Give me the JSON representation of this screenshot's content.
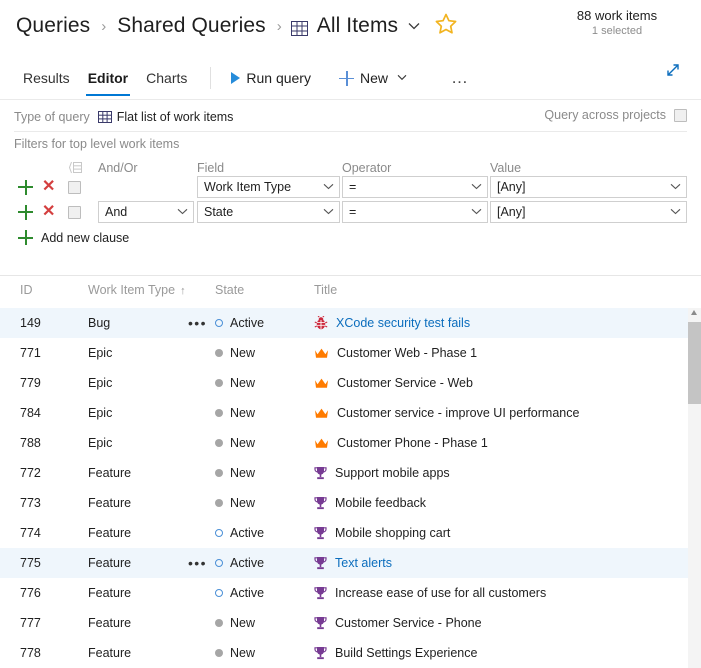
{
  "header": {
    "breadcrumb": [
      {
        "label": "Queries",
        "icon": null
      },
      {
        "label": "Shared Queries",
        "icon": null
      },
      {
        "label": "All Items",
        "icon": "grid-icon"
      }
    ],
    "separator": "›",
    "caret": "⌄",
    "favorite_icon": "star-icon",
    "count_main": "88 work items",
    "count_sub": "1 selected"
  },
  "toolbar": {
    "tabs": [
      {
        "label": "Results",
        "active": false
      },
      {
        "label": "Editor",
        "active": true
      },
      {
        "label": "Charts",
        "active": false
      }
    ],
    "run_query_label": "Run query",
    "run_query_icon": "play-icon",
    "new_label": "New",
    "new_icon": "plus-icon",
    "new_caret": "⌄",
    "overflow_label": "…",
    "expand_icon": "expand-diagonal-icon"
  },
  "query_options": {
    "type_of_query_label": "Type of query",
    "type_of_query_value": "Flat list of work items",
    "type_of_query_icon": "grid-icon",
    "query_across_projects_label": "Query across projects",
    "query_across_projects_checked": false
  },
  "filters": {
    "section_title": "Filters for top level work items",
    "group_icon": "clause-group-icon",
    "columns": {
      "andor": "And/Or",
      "field": "Field",
      "operator": "Operator",
      "value": "Value"
    },
    "add_icon": "plus-icon",
    "remove_icon": "close-icon",
    "caret": "⌄",
    "rows": [
      {
        "andor": "",
        "field": "Work Item Type",
        "operator": "=",
        "value": "[Any]",
        "checked": false
      },
      {
        "andor": "And",
        "field": "State",
        "operator": "=",
        "value": "[Any]",
        "checked": false
      }
    ],
    "add_new_clause_label": "Add new clause"
  },
  "grid": {
    "columns": [
      {
        "key": "id",
        "label": "ID",
        "sorted": false
      },
      {
        "key": "work_item_type",
        "label": "Work Item Type",
        "sorted": true,
        "sort_arrow": "↑"
      },
      {
        "key": "state",
        "label": "State",
        "sorted": false
      },
      {
        "key": "title",
        "label": "Title",
        "sorted": false
      }
    ],
    "rows": [
      {
        "id": "149",
        "type": "Bug",
        "state": "Active",
        "title": "XCode security test fails",
        "icon": "bug-icon",
        "selected": true,
        "menu": true,
        "link": true
      },
      {
        "id": "771",
        "type": "Epic",
        "state": "New",
        "title": "Customer Web - Phase 1",
        "icon": "crown-icon",
        "selected": false,
        "menu": false,
        "link": false
      },
      {
        "id": "779",
        "type": "Epic",
        "state": "New",
        "title": "Customer Service - Web",
        "icon": "crown-icon",
        "selected": false,
        "menu": false,
        "link": false
      },
      {
        "id": "784",
        "type": "Epic",
        "state": "New",
        "title": "Customer service - improve UI performance",
        "icon": "crown-icon",
        "selected": false,
        "menu": false,
        "link": false
      },
      {
        "id": "788",
        "type": "Epic",
        "state": "New",
        "title": "Customer Phone - Phase 1",
        "icon": "crown-icon",
        "selected": false,
        "menu": false,
        "link": false
      },
      {
        "id": "772",
        "type": "Feature",
        "state": "New",
        "title": "Support mobile apps",
        "icon": "trophy-icon",
        "selected": false,
        "menu": false,
        "link": false
      },
      {
        "id": "773",
        "type": "Feature",
        "state": "New",
        "title": "Mobile feedback",
        "icon": "trophy-icon",
        "selected": false,
        "menu": false,
        "link": false
      },
      {
        "id": "774",
        "type": "Feature",
        "state": "Active",
        "title": "Mobile shopping cart",
        "icon": "trophy-icon",
        "selected": false,
        "menu": false,
        "link": false
      },
      {
        "id": "775",
        "type": "Feature",
        "state": "Active",
        "title": "Text alerts",
        "icon": "trophy-icon",
        "selected": true,
        "menu": true,
        "link": true
      },
      {
        "id": "776",
        "type": "Feature",
        "state": "Active",
        "title": "Increase ease of use for all customers",
        "icon": "trophy-icon",
        "selected": false,
        "menu": false,
        "link": false
      },
      {
        "id": "777",
        "type": "Feature",
        "state": "New",
        "title": "Customer Service - Phone",
        "icon": "trophy-icon",
        "selected": false,
        "menu": false,
        "link": false
      },
      {
        "id": "778",
        "type": "Feature",
        "state": "New",
        "title": "Build Settings Experience",
        "icon": "trophy-icon",
        "selected": false,
        "menu": false,
        "link": false
      }
    ],
    "row_menu_icon": "•••"
  },
  "colors": {
    "accent": "#0078d4",
    "link": "#0b6dbd",
    "selected_row": "#eff6fc",
    "bug": "#cc293d",
    "epic": "#ff7b00",
    "feature": "#773b93",
    "add": "#2e8b2e",
    "remove": "#d43f3f",
    "star": "#f2b420",
    "state_new": "#a6a6a6",
    "state_active": "#4a8fd6"
  }
}
